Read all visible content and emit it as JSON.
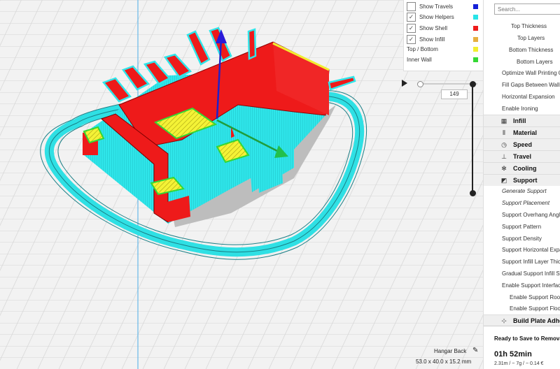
{
  "legend": {
    "items": [
      {
        "label": "Show Travels",
        "checked": false,
        "color": "#1420d8",
        "icon": "checkbox"
      },
      {
        "label": "Show Helpers",
        "checked": true,
        "color": "#28e4e8",
        "icon": "checkbox"
      },
      {
        "label": "Show Shell",
        "checked": true,
        "color": "#ee1c1c",
        "icon": "checkbox"
      },
      {
        "label": "Show Infill",
        "checked": true,
        "color": "#e6b040",
        "icon": "checkbox"
      },
      {
        "label": "Top / Bottom",
        "color": "#f2ee30"
      },
      {
        "label": "Inner Wall",
        "color": "#34d834"
      }
    ],
    "checkmark": "✓"
  },
  "layer_slider": {
    "current_layer": "149",
    "play_icon": "play-icon"
  },
  "search": {
    "placeholder": "Search..."
  },
  "settings": {
    "shell_items": [
      "Top Thickness",
      "Top Layers",
      "Bottom Thickness",
      "Bottom Layers",
      "Optimize Wall Printing Order",
      "Fill Gaps Between Walls",
      "Horizontal Expansion",
      "Enable Ironing"
    ],
    "categories": [
      {
        "label": "Infill",
        "icon": "infill-icon",
        "glyph": "▦"
      },
      {
        "label": "Material",
        "icon": "material-icon",
        "glyph": "⦀"
      },
      {
        "label": "Speed",
        "icon": "speed-icon",
        "glyph": "◷"
      },
      {
        "label": "Travel",
        "icon": "travel-icon",
        "glyph": "⊥"
      },
      {
        "label": "Cooling",
        "icon": "cooling-icon",
        "glyph": "✻"
      },
      {
        "label": "Support",
        "icon": "support-icon",
        "glyph": "◩"
      }
    ],
    "support_items": [
      {
        "label": "Generate Support",
        "italic": true
      },
      {
        "label": "Support Placement",
        "italic": true
      },
      {
        "label": "Support Overhang Angle",
        "italic": false
      },
      {
        "label": "Support Pattern",
        "italic": false
      },
      {
        "label": "Support Density",
        "italic": false
      },
      {
        "label": "Support Horizontal Expansion",
        "italic": false
      },
      {
        "label": "Support Infill Layer Thickness",
        "italic": false
      },
      {
        "label": "Gradual Support Infill Steps",
        "italic": false
      },
      {
        "label": "Enable Support Interface",
        "italic": false
      },
      {
        "label": "Enable Support Roof",
        "italic": false
      },
      {
        "label": "Enable Support Floor",
        "italic": false
      }
    ],
    "adhesion": {
      "label": "Build Plate Adhesion",
      "icon": "adhesion-icon",
      "glyph": "⊹"
    }
  },
  "status": {
    "save": "Ready to Save to Removable Drive",
    "time": "01h 52min",
    "cost": "2.31m / ~ 7g / ~ 0.14 €"
  },
  "object": {
    "name": "Hangar Back",
    "dimensions": "53.0 x 40.0 x 15.2 mm",
    "edit_icon": "pencil-icon"
  }
}
